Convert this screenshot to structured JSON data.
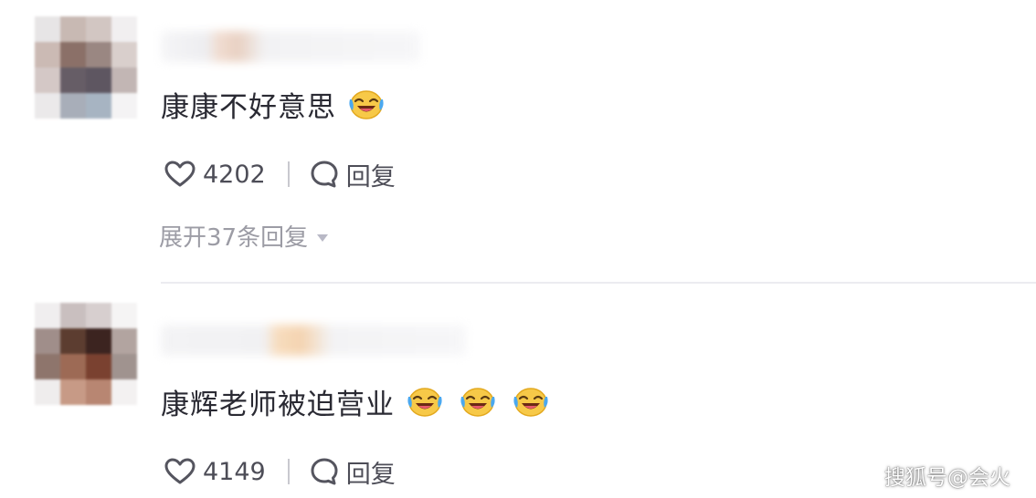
{
  "comments": [
    {
      "text": "康康不好意思",
      "emojis": [
        "laughing-crying-emoji"
      ],
      "likes": "4202",
      "reply_label": "回复",
      "expand_label": "展开37条回复"
    },
    {
      "text": "康辉老师被迫营业",
      "emojis": [
        "laughing-crying-emoji",
        "laughing-crying-emoji",
        "laughing-crying-emoji"
      ],
      "likes": "4149",
      "reply_label": "回复"
    }
  ],
  "watermark": "搜狐号@会火",
  "colors": {
    "text": "#2a2a33",
    "action": "#4d4d57",
    "muted": "#9c9ca5",
    "divider": "#ececf0"
  }
}
